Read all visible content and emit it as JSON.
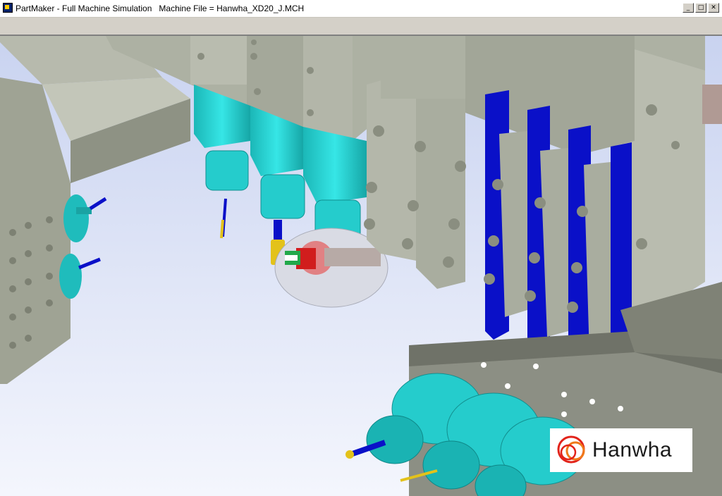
{
  "window": {
    "title": "PartMaker - Full Machine Simulation   Machine File = Hanwha_XD20_J.MCH",
    "minimize_label": "_",
    "maximize_label": "□",
    "close_label": "✕"
  },
  "icons": {
    "app": "partmaker-app-icon",
    "logo": "hanwha-logo-icon"
  },
  "logo": {
    "brand": "Hanwha",
    "brand_color": "#e2231a"
  },
  "colors": {
    "sky": "#e8eefc",
    "machine_gray": "#a9ad9e",
    "tool_cyan": "#2ed6d6",
    "tool_blue": "#0a10c8",
    "insert_yellow": "#e3c21a",
    "part_red": "#d11d1d"
  }
}
